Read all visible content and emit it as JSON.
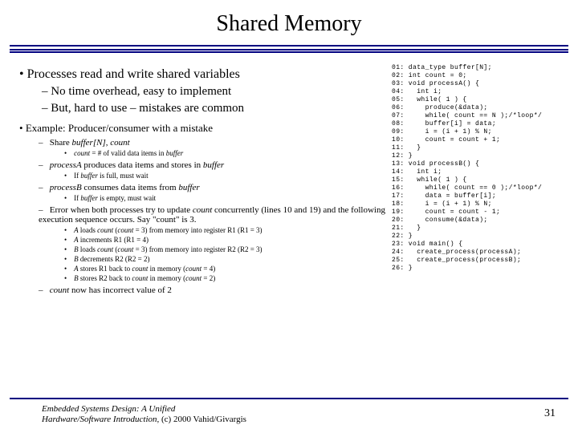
{
  "title": "Shared Memory",
  "left": {
    "b1": "Processes read and write shared variables",
    "sub1a": "No time overhead, easy to implement",
    "sub1b": "But, hard to use – mistakes are common",
    "b2": "Example: Producer/consumer with a mistake",
    "s2a": "Share <em>buffer[N]</em>, <em>count</em>",
    "s3a": "<em>count</em> = # of valid data items in <em>buffer</em>",
    "s2b": "<em>processA</em> produces data items and stores in <em>buffer</em>",
    "s3b": "If <em>buffer</em> is full, must wait",
    "s2c": "<em>processB</em> consumes data items from <em>buffer</em>",
    "s3c": "If <em>buffer</em> is empty, must wait",
    "s2d": "Error when both processes try to update <em>count</em> concurrently (lines 10 and 19) and the following execution sequence occurs. Say \"count\" is 3.",
    "s3d1": "<em>A</em> loads <em>count</em> (<em>count</em> = 3) from memory into register R1 (R1 = 3)",
    "s3d2": "<em>A</em> increments R1 (R1 = 4)",
    "s3d3": "<em>B</em> loads <em>count</em> (<em>count</em> = 3) from memory into register R2 (R2 = 3)",
    "s3d4": "<em>B</em> decrements R2 (R2 = 2)",
    "s3d5": "<em>A</em> stores R1 back to <em>count</em> in memory (<em>count</em> = 4)",
    "s3d6": "<em>B</em> stores R2 back to <em>count</em> in memory (<em>count</em> = 2)",
    "s2e": "<em>count</em> now has incorrect value of 2"
  },
  "code": "01: data_type buffer[N];\n02: int count = 0;\n03: void processA() {\n04:   int i;\n05:   while( 1 ) {\n06:     produce(&data);\n07:     while( count == N );/*loop*/\n08:     buffer[i] = data;\n09:     i = (i + 1) % N;\n10:     count = count + 1;\n11:   }\n12: }\n13: void processB() {\n14:   int i;\n15:   while( 1 ) {\n16:     while( count == 0 );/*loop*/\n17:     data = buffer[i];\n18:     i = (i + 1) % N;\n19:     count = count - 1;\n20:     consume(&data);\n21:   }\n22: }\n23: void main() {\n24:   create_process(processA);\n25:   create_process(processB);\n26: }",
  "footer": {
    "line1": "Embedded Systems Design: A Unified",
    "line2": "Hardware/Software Introduction, <span style=\"font-style:normal\">(c) 2000 Vahid/Givargis</span>"
  },
  "pagenum": "31"
}
